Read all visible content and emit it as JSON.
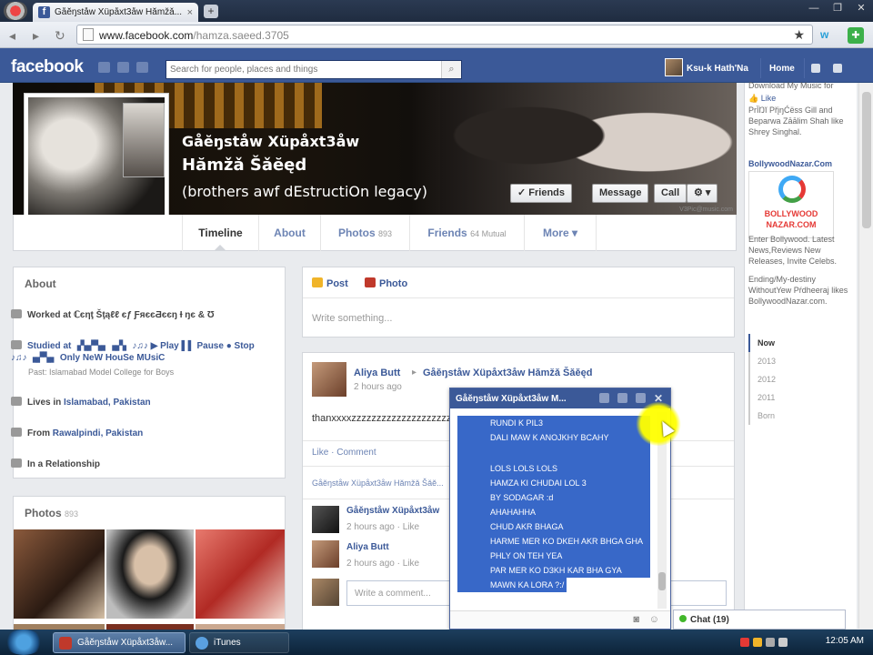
{
  "browser": {
    "tab_title": "Gåĕŋståw Xüpåxt3åw Hămžǎ...",
    "tab_close": "×",
    "new_tab": "+",
    "url_host": "www.facebook.com",
    "url_path": "/hamza.saeed.3705",
    "nav_back": "◂",
    "nav_forward": "▸",
    "nav_reload": "↻",
    "star": "★",
    "window_controls": [
      "—",
      "❐",
      "✕"
    ]
  },
  "fbbar": {
    "logo": "facebook",
    "search_placeholder": "Search for people, places and things",
    "search_icon": "⌕",
    "user_name": "Ksu-k Hath'Na",
    "home": "Home"
  },
  "profile": {
    "name_line1": "Gåĕŋståw Xüpåxt3åw",
    "name_line2": "Hămžǎ Šǎĕęd",
    "tagline": "(brothers awf dEstructiOn legacy)",
    "buttons": {
      "friends": "✓ Friends",
      "message": "Message",
      "call": "Call",
      "gear": "⚙ ▾"
    },
    "cover_credit": "V3Pic@music.com",
    "tabs": [
      {
        "label": "Timeline",
        "count": ""
      },
      {
        "label": "About",
        "count": ""
      },
      {
        "label": "Photos",
        "count": "893"
      },
      {
        "label": "Friends",
        "count": "64 Mutual"
      },
      {
        "label": "More ▾",
        "count": ""
      }
    ]
  },
  "about": {
    "title": "About",
    "worked": "Worked at ℂєηţ Šţąℓℓ єƒ ƑяєєƋєєŋ Ɨ ŋє & Ʊ",
    "studied": "Studied at ▗▚▞▚▖▗▞▖ ♪♫♪ ▶ Play ▌▌ Pause ● Stop ♪♫♪ ▗▞▚▖ Only NeW HouSe MUsiC",
    "studied_sub": "Past: Islamabad Model College for Boys",
    "lives_prefix": "Lives in ",
    "lives": "Islamabad, Pakistan",
    "from_prefix": "From ",
    "from": "Rawalpindi, Pakistan",
    "relationship": "In a Relationship"
  },
  "photos_box": {
    "title": "Photos",
    "count": "893"
  },
  "composer": {
    "tab_post": "Post",
    "tab_photo": "Photo",
    "placeholder": "Write something..."
  },
  "story": {
    "author": "Aliya Butt",
    "arrow": "▸",
    "target": "Gåĕŋståw Xüpåxt3åw Hămžǎ Šǎĕęd",
    "time": "2 hours ago",
    "text": "thanxxxxzzzzzzzzzzzzzzzzzzzzz",
    "like": "Like",
    "comment": "Comment",
    "commenters_line": "Gåĕŋståw Xüpåxt3åw Hămžǎ Šǎĕ...",
    "comments": [
      {
        "name": "Gåĕŋståw Xüpåxt3åw",
        "time": "2 hours ago · Like"
      },
      {
        "name": "Aliya Butt",
        "time": "2 hours ago · Like"
      }
    ],
    "comment_placeholder": "Write a comment..."
  },
  "chat": {
    "title": "Gåĕŋståw Xüpåxt3åw M...",
    "close": "✕",
    "lines": [
      "RUNDI K PIL3",
      "DALI MAW K ANOJKHY   BCAHY",
      "",
      "LOLS LOLS LOLS",
      "HAMZA KI CHUDAI  LOL 3",
      "BY SODAGAR :d",
      "AHAHAHHA",
      "CHUD AKR BHAGA",
      "HARME MER KO  DKEH AKR BHGA GHA",
      "PHLY ON TEH YEA",
      "PAR MER KO D3KH KAR BHA GYA",
      "MAWN KA LORA ?:/"
    ]
  },
  "chat_sidebar": {
    "label": "Chat (19)"
  },
  "rightcol": {
    "ad1_text": "Download My Music for",
    "ad1_like": "Like",
    "ad1_likers": "PrÏŊĭ PřįŋĆëss Gill and Beparwa Zāālim Shah like Shrey Singhal.",
    "ad2_title": "BollywoodNazar.Com",
    "ad2_img_label": "BOLLYWOOD NAZAR.COM",
    "ad2_desc": "Enter Bollywood. Latest News,Reviews New Releases, Invite Celebs.",
    "ad2_likers": "Ending/My-destiny WithoutYew Pŕdheeraj likes BollywoodNazar.com.",
    "years": [
      "Now",
      "2013",
      "2012",
      "2011",
      "Born"
    ]
  },
  "taskbar": {
    "task1": "Gåĕŋståw Xüpåxt3åw...",
    "task2": "iTunes",
    "clock": "12:05 AM"
  }
}
